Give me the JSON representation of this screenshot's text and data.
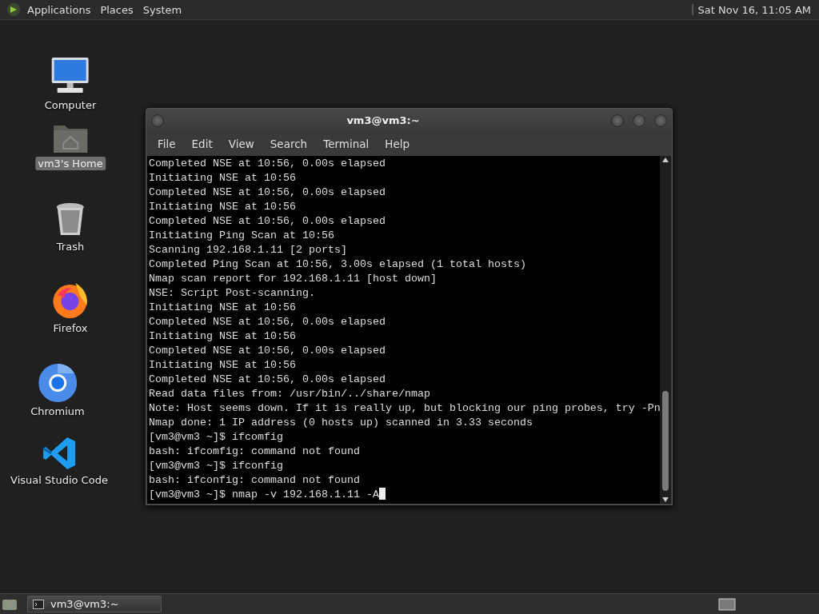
{
  "top_panel": {
    "menus": [
      "Applications",
      "Places",
      "System"
    ],
    "clock": "Sat Nov 16, 11:05 AM"
  },
  "desktop_icons": [
    {
      "kind": "computer",
      "label": "Computer",
      "selected": false
    },
    {
      "kind": "home",
      "label": "vm3's Home",
      "selected": true
    },
    {
      "kind": "trash",
      "label": "Trash",
      "selected": false
    },
    {
      "kind": "firefox",
      "label": "Firefox",
      "selected": false
    },
    {
      "kind": "chromium",
      "label": "Chromium",
      "selected": false
    },
    {
      "kind": "vscode",
      "label": "Visual Studio Code",
      "selected": false
    }
  ],
  "window": {
    "title": "vm3@vm3:~",
    "menu": [
      "File",
      "Edit",
      "View",
      "Search",
      "Terminal",
      "Help"
    ],
    "lines": [
      "Completed NSE at 10:56, 0.00s elapsed",
      "Initiating NSE at 10:56",
      "Completed NSE at 10:56, 0.00s elapsed",
      "Initiating NSE at 10:56",
      "Completed NSE at 10:56, 0.00s elapsed",
      "Initiating Ping Scan at 10:56",
      "Scanning 192.168.1.11 [2 ports]",
      "Completed Ping Scan at 10:56, 3.00s elapsed (1 total hosts)",
      "Nmap scan report for 192.168.1.11 [host down]",
      "NSE: Script Post-scanning.",
      "Initiating NSE at 10:56",
      "Completed NSE at 10:56, 0.00s elapsed",
      "Initiating NSE at 10:56",
      "Completed NSE at 10:56, 0.00s elapsed",
      "Initiating NSE at 10:56",
      "Completed NSE at 10:56, 0.00s elapsed",
      "Read data files from: /usr/bin/../share/nmap",
      "Note: Host seems down. If it is really up, but blocking our ping probes, try -Pn",
      "Nmap done: 1 IP address (0 hosts up) scanned in 3.33 seconds",
      "[vm3@vm3 ~]$ ifcomfig",
      "bash: ifcomfig: command not found",
      "[vm3@vm3 ~]$ ifconfig",
      "bash: ifconfig: command not found",
      "[vm3@vm3 ~]$ nmap -v 192.168.1.11 -A"
    ]
  },
  "taskbar": {
    "tasks": [
      {
        "label": "vm3@vm3:~",
        "selected": true
      }
    ]
  }
}
